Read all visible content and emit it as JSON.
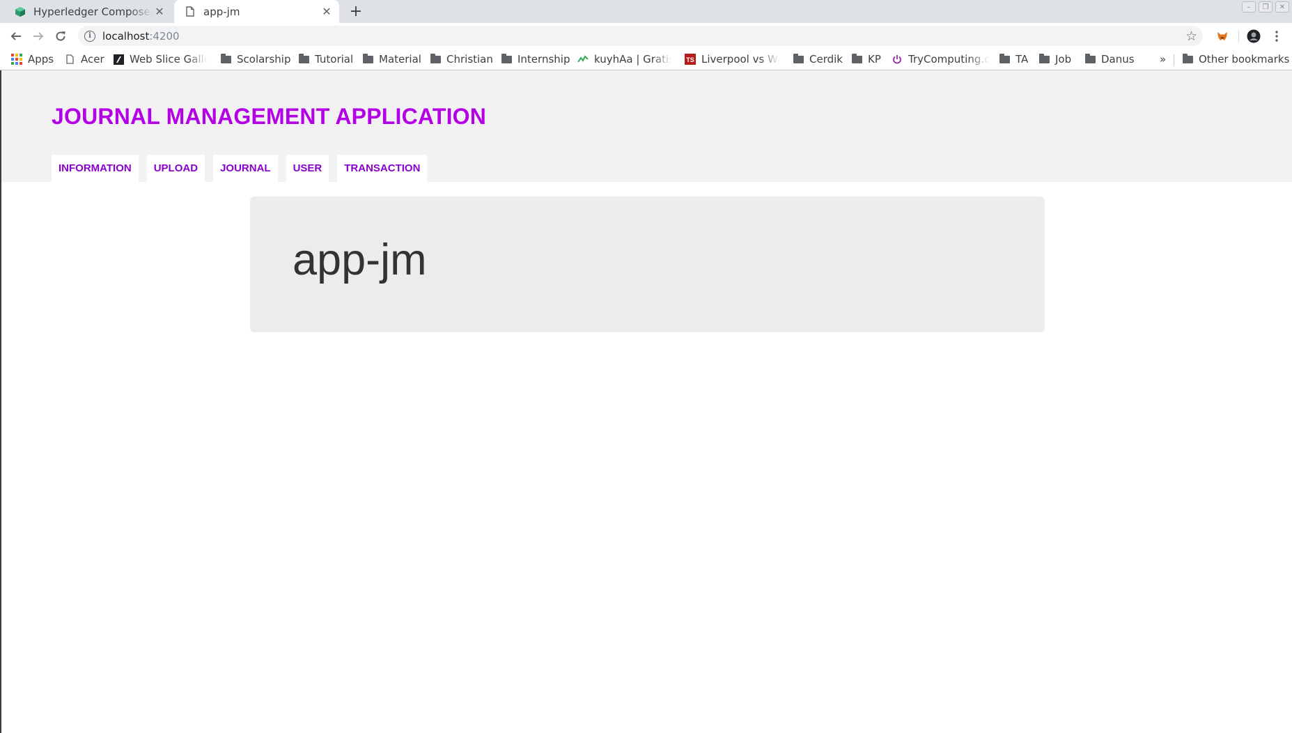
{
  "browser": {
    "tabs": [
      {
        "title": "Hyperledger Composer Rest Server",
        "active": false,
        "icon": "composer-cube-icon"
      },
      {
        "title": "app-jm",
        "active": true,
        "icon": "page-icon"
      }
    ],
    "newtab": "+",
    "url_host": "localhost",
    "url_port": ":4200",
    "bookmarks": [
      {
        "label": "Apps",
        "icon": "apps-grid-icon"
      },
      {
        "label": "Acer",
        "icon": "page-icon"
      },
      {
        "label": "Web Slice Gallery",
        "icon": "web-slice-icon"
      },
      {
        "label": "Scolarship",
        "icon": "folder-icon"
      },
      {
        "label": "Tutorial",
        "icon": "folder-icon"
      },
      {
        "label": "Material",
        "icon": "folder-icon"
      },
      {
        "label": "Christian",
        "icon": "folder-icon"
      },
      {
        "label": "Internship",
        "icon": "folder-icon"
      },
      {
        "label": "kuyhAa | Gratis Download",
        "icon": "kuyhaa-icon"
      },
      {
        "label": "Liverpool vs Watford",
        "icon": "ts-icon"
      },
      {
        "label": "Cerdik",
        "icon": "folder-icon"
      },
      {
        "label": "KP",
        "icon": "folder-icon"
      },
      {
        "label": "TryComputing.org",
        "icon": "power-icon"
      },
      {
        "label": "TA",
        "icon": "folder-icon"
      },
      {
        "label": "Job",
        "icon": "folder-icon"
      },
      {
        "label": "Danus",
        "icon": "folder-icon"
      }
    ],
    "more_bookmarks": "»",
    "other_bookmarks": "Other bookmarks"
  },
  "app": {
    "title": "JOURNAL MANAGEMENT APPLICATION",
    "nav": [
      "INFORMATION",
      "UPLOAD",
      "JOURNAL",
      "USER",
      "TRANSACTION"
    ],
    "heading": "app-jm"
  },
  "colors": {
    "brand_title": "#b300e6",
    "nav_text": "#8a00cc",
    "header_bg": "#f2f2f2",
    "jumbotron_bg": "#ececec"
  }
}
